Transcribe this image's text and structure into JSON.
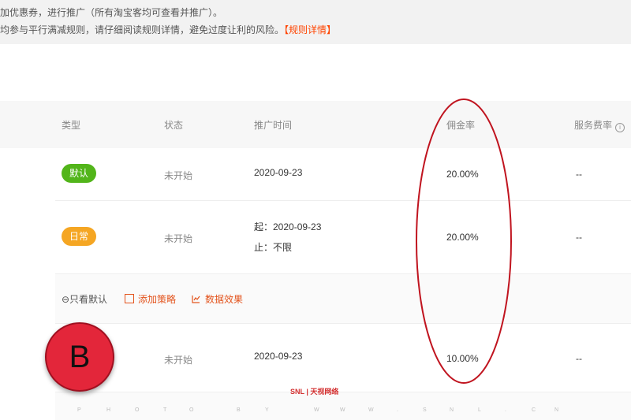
{
  "notice": {
    "line1": "加优惠券，进行推广（所有淘宝客均可查看并推广）。",
    "line2": "均参与平行满减规则，请仔细阅读规则详情，避免过度让利的风险。",
    "rules_link": "【规则详情】"
  },
  "table": {
    "headers": {
      "type": "类型",
      "status": "状态",
      "time": "推广时间",
      "commission": "佣金率",
      "service_fee": "服务费率",
      "info_icon": "i"
    },
    "rows": [
      {
        "tag": "默认",
        "tag_color": "#52b51a",
        "status": "未开始",
        "time": "2020-09-23",
        "commission": "20.00%",
        "service_fee": "--"
      },
      {
        "tag": "日常",
        "tag_color": "#f5a623",
        "status": "未开始",
        "time_start": "起：2020-09-23",
        "time_end": "止：不限",
        "commission": "20.00%",
        "service_fee": "--"
      },
      {
        "tag": "",
        "tag_color": "#e53935",
        "status": "未开始",
        "time": "2020-09-23",
        "commission": "10.00%",
        "service_fee": "--"
      }
    ],
    "actions": {
      "only_default": "⊖只看默认",
      "add_strategy": "添加策略",
      "data_effect": "数据效果"
    }
  },
  "overlay": {
    "badge_letter": "B"
  },
  "watermark": {
    "logo": "SNL | 天视网络",
    "letters": [
      "P",
      "H",
      "O",
      "T",
      "O",
      "B",
      "Y",
      "W",
      "W",
      "W",
      ".",
      "S",
      "N",
      "L",
      ".",
      "C",
      "N"
    ]
  }
}
